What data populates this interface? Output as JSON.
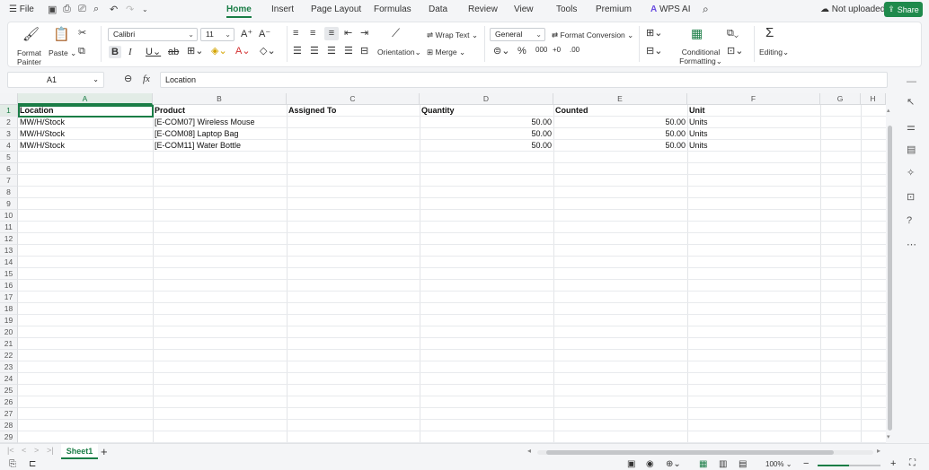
{
  "menu": {
    "file": "File",
    "tabs": [
      "Home",
      "Insert",
      "Page Layout",
      "Formulas",
      "Data",
      "Review",
      "View",
      "Tools",
      "Premium"
    ],
    "active_tab": "Home",
    "wps_ai": "WPS AI",
    "upload_status": "Not uploaded",
    "share": "Share"
  },
  "ribbon": {
    "format_painter": "Format Painter",
    "paste": "Paste",
    "font_name": "Calibri",
    "font_size": "11",
    "wrap_text": "Wrap Text",
    "orientation": "Orientation",
    "merge": "Merge",
    "number_format": "General",
    "format_conversion": "Format Conversion",
    "conditional_formatting": "Conditional Formatting",
    "editing": "Editing"
  },
  "formula_bar": {
    "cell_ref": "A1",
    "fx": "fx",
    "content": "Location"
  },
  "sheet": {
    "columns": [
      "A",
      "B",
      "C",
      "D",
      "E",
      "F",
      "G",
      "H"
    ],
    "selected_column": "A",
    "row_numbers": [
      "1",
      "2",
      "3",
      "4",
      "5",
      "6",
      "7",
      "8",
      "9",
      "10",
      "11",
      "12",
      "13",
      "14",
      "15",
      "16",
      "17",
      "18",
      "19",
      "20",
      "21",
      "22",
      "23",
      "24",
      "25",
      "26",
      "27",
      "28",
      "29"
    ],
    "headers": [
      "Location",
      "Product",
      "Assigned To",
      "Quantity",
      "Counted",
      "Unit"
    ],
    "rows": [
      [
        "MW/H/Stock",
        "[E-COM07] Wireless Mouse",
        "",
        "50.00",
        "50.00",
        "Units"
      ],
      [
        "MW/H/Stock",
        "[E-COM08] Laptop Bag",
        "",
        "50.00",
        "50.00",
        "Units"
      ],
      [
        "MW/H/Stock",
        "[E-COM11] Water Bottle",
        "",
        "50.00",
        "50.00",
        "Units"
      ]
    ]
  },
  "sheet_tabs": {
    "active": "Sheet1"
  },
  "status": {
    "zoom": "100%"
  },
  "colors": {
    "accent": "#1a7d46",
    "share_bg": "#1f8a4c"
  }
}
